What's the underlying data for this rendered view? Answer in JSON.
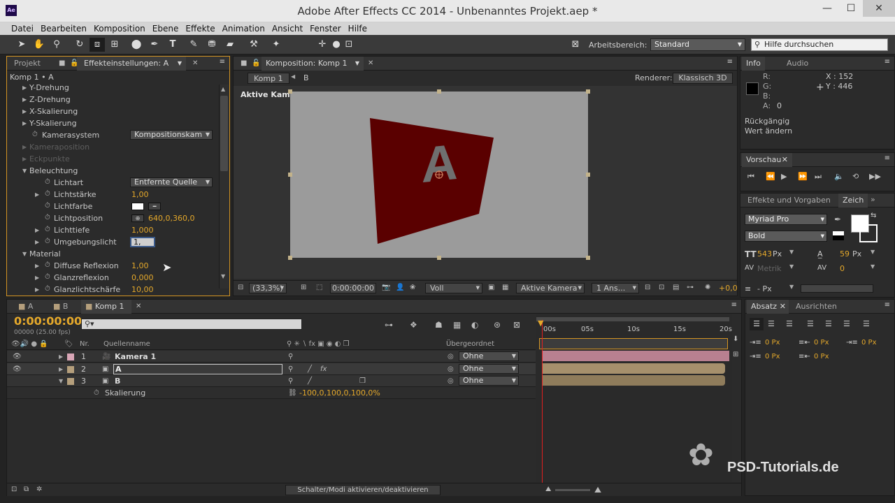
{
  "window": {
    "title": "Adobe After Effects CC 2014 - Unbenanntes Projekt.aep *",
    "app_icon": "Ae",
    "minimize": "—",
    "maximize": "☐",
    "close": "✕"
  },
  "menu": [
    "Datei",
    "Bearbeiten",
    "Komposition",
    "Ebene",
    "Effekte",
    "Animation",
    "Ansicht",
    "Fenster",
    "Hilfe"
  ],
  "toolbar": {
    "workspace_label": "Arbeitsbereich:",
    "workspace_value": "Standard",
    "help_placeholder": "Hilfe durchsuchen"
  },
  "effects_panel": {
    "tab_project": "Projekt",
    "tab_effects": "Effekteinstellungen: A",
    "breadcrumb": "Komp 1 • A",
    "rows": {
      "y_rot": "Y-Drehung",
      "z_rot": "Z-Drehung",
      "x_scale": "X-Skalierung",
      "y_scale": "Y-Skalierung",
      "camsys": "Kamerasystem",
      "camsys_val": "Kompositionskam",
      "campos": "Kameraposition",
      "corners": "Eckpunkte",
      "lighting": "Beleuchtung",
      "lightkind": "Lichtart",
      "lightkind_val": "Entfernte Quelle",
      "intensity": "Lichtstärke",
      "intensity_val": "1,00",
      "lightcolor": "Lichtfarbe",
      "lightpos": "Lichtposition",
      "lightpos_val": "640,0,360,0",
      "lightdepth": "Lichttiefe",
      "lightdepth_val": "1,000",
      "ambient": "Umgebungslicht",
      "ambient_val": "1,",
      "material": "Material",
      "diffuse": "Diffuse Reflexion",
      "diffuse_val": "1,00",
      "specular": "Glanzreflexion",
      "specular_val": "0,000",
      "shine": "Glanzlichtschärfe",
      "shine_val": "10,00"
    }
  },
  "comp_panel": {
    "tab": "Komposition: Komp 1",
    "crumb_active": "Komp 1",
    "crumb_b": "B",
    "renderer_label": "Renderer:",
    "renderer_value": "Klassisch 3D",
    "camera_label": "Aktive Kamera",
    "layer_letter": "A",
    "zoom": "(33,3%)",
    "timecode": "0:00:00:00",
    "resolution": "Voll",
    "view": "Aktive Kamera",
    "views": "1 Ans...",
    "exposure": "+0,0"
  },
  "info_panel": {
    "tab_info": "Info",
    "tab_audio": "Audio",
    "r": "R:",
    "g": "G:",
    "b": "B:",
    "a": "A:",
    "a_val": "0",
    "x": "X : 152",
    "y": "Y : 446",
    "undo": "Rückgängig",
    "undo_detail": "Wert ändern"
  },
  "preview_panel": {
    "tab": "Vorschau"
  },
  "fx_panel": {
    "tab_fx": "Effekte und Vorgaben",
    "tab_char": "Zeich",
    "font": "Myriad Pro",
    "style": "Bold",
    "size": "543",
    "size_unit": "Px",
    "leading": "59",
    "leading_unit": "Px",
    "kerning": "Metrik",
    "tracking": "0",
    "stroke_unit": "- Px"
  },
  "timeline": {
    "tab_a": "A",
    "tab_b": "B",
    "tab_comp": "Komp 1",
    "timecode": "0:00:00:00",
    "frames": "00000 (25.00 fps)",
    "col_nr": "Nr.",
    "col_source": "Quellenname",
    "col_parent": "Übergeordnet",
    "ruler": [
      "00s",
      "05s",
      "10s",
      "15s",
      "20s"
    ],
    "layers": [
      {
        "nr": "1",
        "name": "Kamera 1",
        "parent": "Ohne"
      },
      {
        "nr": "2",
        "name": "A",
        "parent": "Ohne"
      },
      {
        "nr": "3",
        "name": "B",
        "parent": "Ohne"
      }
    ],
    "scale_label": "Skalierung",
    "scale_value": "-100,0,100,0,100,0%",
    "toggle_button": "Schalter/Modi aktivieren/deaktivieren"
  },
  "para_panel": {
    "tab_para": "Absatz",
    "tab_hint": "Ausrichten",
    "indent_unit": "0 Px"
  },
  "watermark": "PSD-Tutorials.de",
  "colors": {
    "accent": "#e4a82b",
    "layer_solid": "#5a0000",
    "comp_bg": "#9b9b9b",
    "camera_label": "#d9a6b6",
    "layer_label": "#b59f7c"
  }
}
